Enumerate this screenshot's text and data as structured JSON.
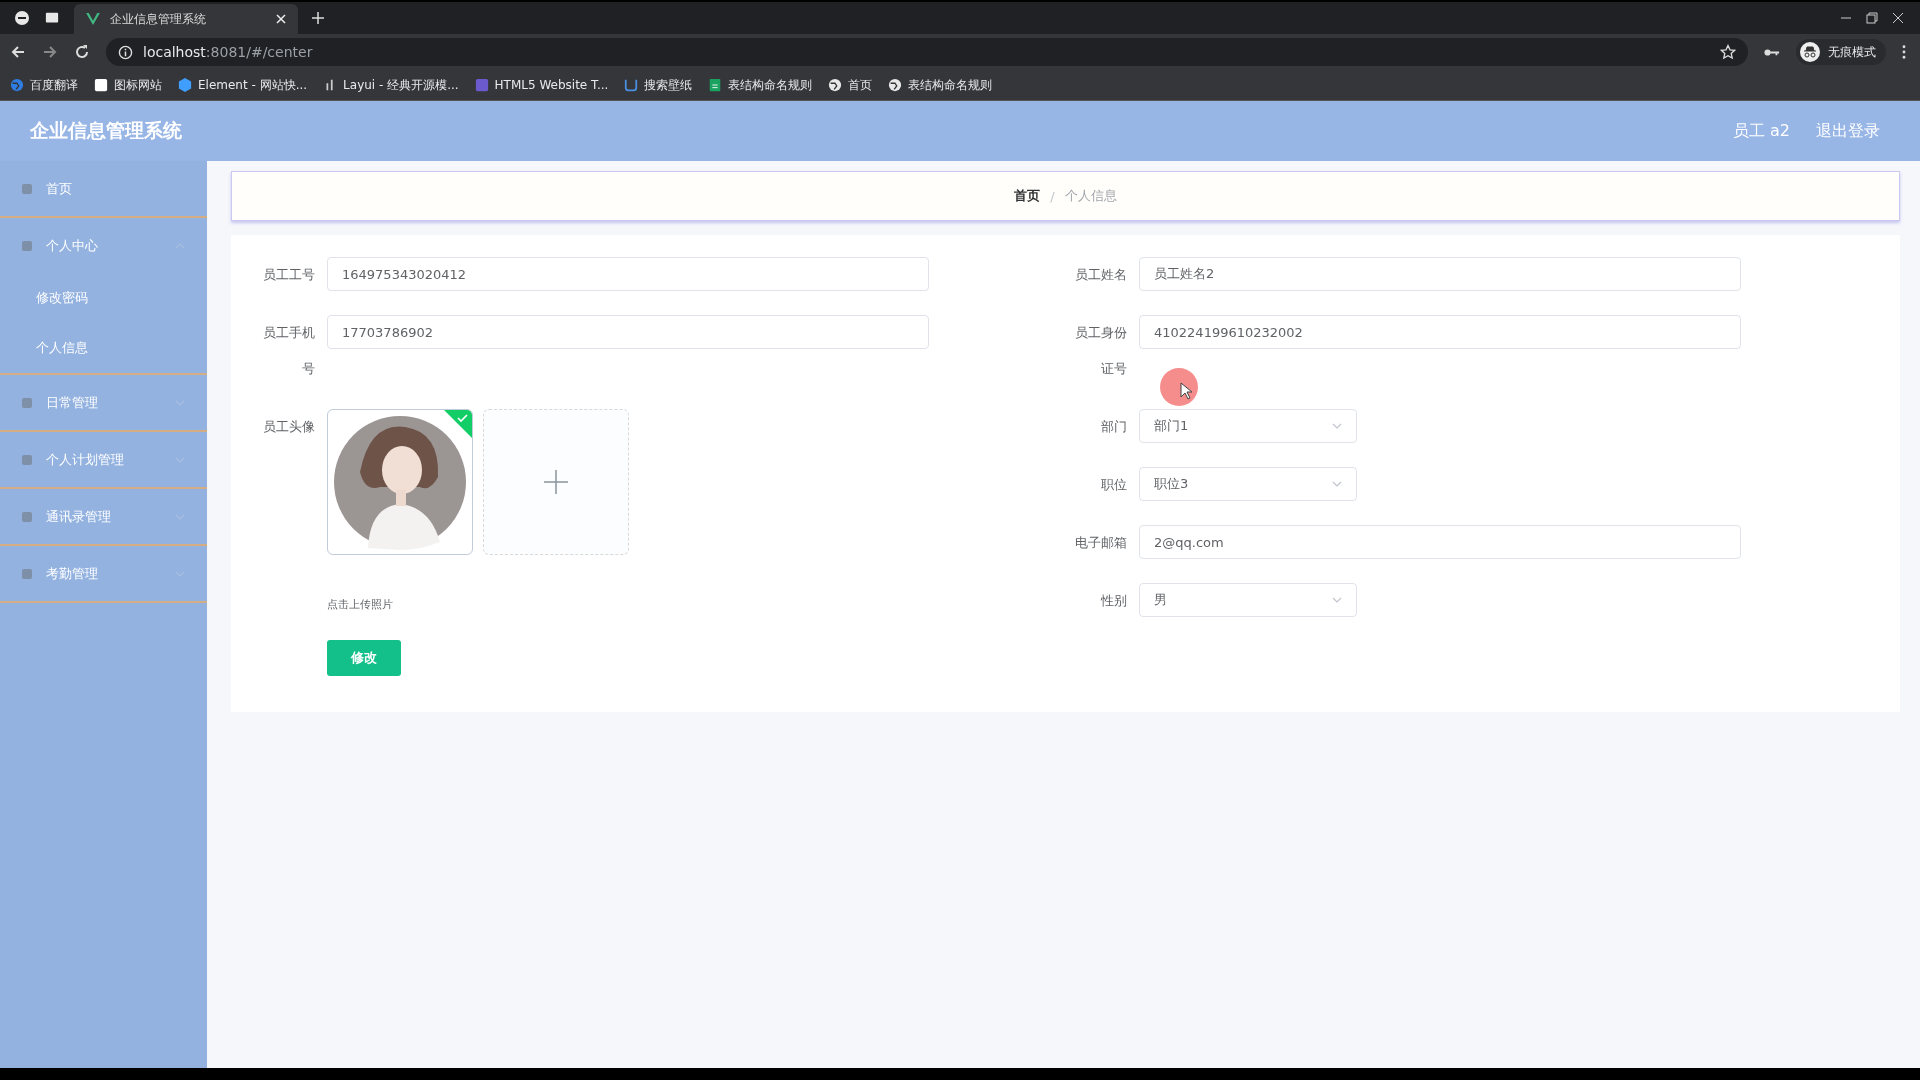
{
  "browser": {
    "tab_title": "企业信息管理系统",
    "url_host": "localhost",
    "url_rest": ":8081/#/center",
    "profile": "无痕模式",
    "bookmarks": [
      {
        "label": "百度翻译",
        "color": "#2f7de1"
      },
      {
        "label": "图标网站",
        "color": "#ffffff"
      },
      {
        "label": "Element - 网站快...",
        "color": "#409eff"
      },
      {
        "label": "Layui - 经典开源模...",
        "color": "#cccccc"
      },
      {
        "label": "HTML5 Website T...",
        "color": "#6a5acd"
      },
      {
        "label": "搜索壁纸",
        "color": "#4a90e2"
      },
      {
        "label": "表结构命名规则",
        "color": "#1aa260"
      },
      {
        "label": "首页",
        "color": "#e8e8e8"
      },
      {
        "label": "表结构命名规则",
        "color": "#e8e8e8"
      }
    ]
  },
  "header": {
    "title": "企业信息管理系统",
    "user": "员工 a2",
    "logout": "退出登录"
  },
  "sidebar": {
    "items": [
      {
        "label": "首页",
        "kind": "link"
      },
      {
        "label": "个人中心",
        "kind": "menu",
        "expanded": true,
        "children": [
          {
            "label": "修改密码"
          },
          {
            "label": "个人信息"
          }
        ]
      },
      {
        "label": "日常管理",
        "kind": "menu",
        "expanded": false
      },
      {
        "label": "个人计划管理",
        "kind": "menu",
        "expanded": false
      },
      {
        "label": "通讯录管理",
        "kind": "menu",
        "expanded": false
      },
      {
        "label": "考勤管理",
        "kind": "menu",
        "expanded": false
      }
    ]
  },
  "breadcrumb": [
    "首页",
    "个人信息"
  ],
  "breadcrumb_separator": "/",
  "form": {
    "left": [
      {
        "label": "员工工号",
        "value": "164975343020412"
      },
      {
        "label": "员工手机号",
        "value": "17703786902"
      }
    ],
    "avatar": {
      "label": "员工头像",
      "uploaded": true,
      "hint": "点击上传照片"
    },
    "right": [
      {
        "label": "员工姓名",
        "kind": "text",
        "value": "员工姓名2"
      },
      {
        "label": "员工身份证号",
        "kind": "text",
        "value": "410224199610232002"
      },
      {
        "label": "部门",
        "kind": "select",
        "value": "部门1"
      },
      {
        "label": "职位",
        "kind": "select",
        "value": "职位3"
      },
      {
        "label": "电子邮箱",
        "kind": "text",
        "value": "2@qq.com"
      },
      {
        "label": "性别",
        "kind": "select",
        "value": "男"
      }
    ],
    "submit": "修改"
  }
}
